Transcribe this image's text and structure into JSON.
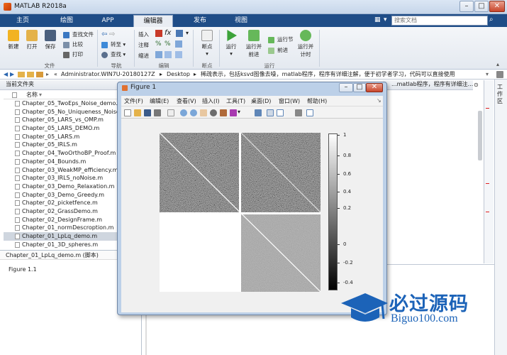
{
  "window": {
    "title": "MATLAB R2018a"
  },
  "tabs": [
    "主页",
    "绘图",
    "APP",
    "编辑器",
    "发布",
    "视图"
  ],
  "search": {
    "placeholder": "搜索文档"
  },
  "ribbon": {
    "file_group": {
      "label": "文件",
      "new": "新建",
      "open": "打开",
      "save": "保存",
      "find_files": "查找文件",
      "compare": "比较",
      "print": "打印"
    },
    "nav_group": {
      "label": "导航",
      "goto": "转至",
      "find": "查找"
    },
    "edit_group": {
      "label": "编辑",
      "insert": "插入",
      "comment": "注释",
      "indent": "缩进",
      "fx": "fx"
    },
    "breakpoints_group": {
      "label": "断点",
      "breakpoints": "断点"
    },
    "run_group": {
      "label": "运行",
      "run": "运行",
      "run_advance": "运行并\n前进",
      "run_section": "运行节",
      "advance": "前进",
      "run_time": "运行并\n计时"
    }
  },
  "path": {
    "root": "«",
    "segments": [
      "Administrator.WIN7U-20180127Z",
      "Desktop",
      "稀疏表示，包括ksvd图像去噪，matlab程序，程序有详细注解，便于初学者学习，代码可以直接使用"
    ]
  },
  "current_folder": {
    "title": "当前文件夹",
    "column": "名称"
  },
  "files": [
    "Chapter_05_TwoEps_Noise_demo.m",
    "Chapter_05_No_Uniqueness_Noise",
    "Chapter_05_LARS_vs_OMP.m",
    "Chapter_05_LARS_DEMO.m",
    "Chapter_05_LARS.m",
    "Chapter_05_IRLS.m",
    "Chapter_04_TwoOrthoBP_Proof.m",
    "Chapter_04_Bounds.m",
    "Chapter_03_WeakMP_efficiency.m",
    "Chapter_03_IRLS_noNoise.m",
    "Chapter_03_Demo_Relaxation.m",
    "Chapter_03_Demo_Greedy.m",
    "Chapter_02_picketfence.m",
    "Chapter_02_GrassDemo.m",
    "Chapter_02_DesignFrame.m",
    "Chapter_01_normDescroption.m",
    "Chapter_01_LpLq_demo.m",
    "Chapter_01_3D_spheres.m"
  ],
  "selected_file_index": 16,
  "details": {
    "file": "Chapter_01_LpLq_demo.m",
    "kind": "(脚本)",
    "description": "Figure 1.1"
  },
  "editor_tab": {
    "label": "...matlab程序，程序有详细注..."
  },
  "right_panel": {
    "label": "工作区"
  },
  "figure": {
    "title": "Figure 1",
    "menus": [
      "文件(F)",
      "编辑(E)",
      "查看(V)",
      "插入(I)",
      "工具(T)",
      "桌面(D)",
      "窗口(W)",
      "帮助(H)"
    ],
    "colorbar_ticks": [
      "1",
      "0.8",
      "0.6",
      "0.4",
      "0.2",
      "0",
      "-0.2",
      "-0.4"
    ]
  },
  "watermark": {
    "brand": "必过源码",
    "url": "Biguo100.com"
  },
  "colors": {
    "accent": "#1f4d87",
    "run_green": "#3da33a",
    "brand_blue": "#1c63b8"
  }
}
